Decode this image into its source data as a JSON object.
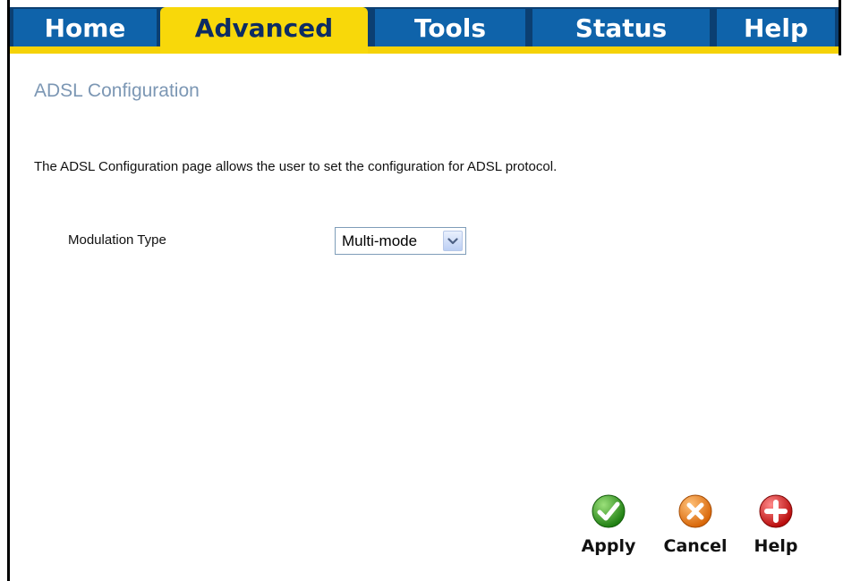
{
  "nav": {
    "tabs": [
      {
        "label": "Home",
        "active": false
      },
      {
        "label": "Advanced",
        "active": true
      },
      {
        "label": "Tools",
        "active": false
      },
      {
        "label": "Status",
        "active": false
      },
      {
        "label": "Help",
        "active": false
      }
    ]
  },
  "page": {
    "title": "ADSL Configuration",
    "description": "The ADSL Configuration page allows the user to set the configuration for ADSL protocol."
  },
  "form": {
    "modulation_label": "Modulation Type",
    "modulation_value": "Multi-mode"
  },
  "actions": {
    "apply_label": "Apply",
    "cancel_label": "Cancel",
    "help_label": "Help"
  },
  "colors": {
    "nav_dark": "#0b3f72",
    "nav_tab": "#0f63aa",
    "active_tab": "#f8d80a",
    "title": "#7c97b4",
    "apply_green": "#2f9e1f",
    "cancel_orange": "#ee7d12",
    "help_red": "#cc1111"
  }
}
